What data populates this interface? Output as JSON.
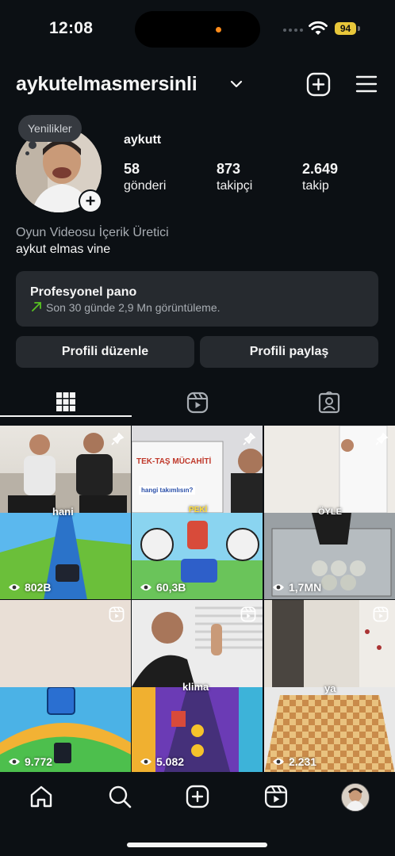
{
  "status_bar": {
    "time": "12:08",
    "battery": "94"
  },
  "header": {
    "username": "aykutelmasmersinli"
  },
  "profile": {
    "note": "Yenilikler",
    "display_name": "aykutt",
    "stats": [
      {
        "value": "58",
        "label": "gönderi"
      },
      {
        "value": "873",
        "label": "takipçi"
      },
      {
        "value": "2.649",
        "label": "takip"
      }
    ],
    "category": "Oyun Videosu İçerik Üretici",
    "bio": "aykut elmas vine"
  },
  "dashboard": {
    "title": "Profesyonel pano",
    "subtitle": "Son 30 günde 2,9 Mn görüntüleme."
  },
  "buttons": {
    "edit": "Profili düzenle",
    "share": "Profili paylaş"
  },
  "tabs": [
    "grid-icon",
    "reels-icon",
    "tagged-icon"
  ],
  "grid": [
    {
      "views": "802B",
      "tag": "hani",
      "icon": "pin-icon"
    },
    {
      "views": "60,3B",
      "tag": "PEKİ",
      "icon": "pin-icon",
      "board_text": "TEK-TAŞ MÜCAHİTİ",
      "caption": "hangi takımlısın?"
    },
    {
      "views": "1,7MN",
      "tag": "ÖYLE",
      "icon": "pin-icon"
    },
    {
      "views": "9.772",
      "tag": "",
      "icon": "reels-icon"
    },
    {
      "views": "5.082",
      "tag": "klima",
      "icon": "reels-icon"
    },
    {
      "views": "2.231",
      "tag": "ya",
      "icon": "reels-icon"
    }
  ],
  "bottom_nav": [
    "home-icon",
    "search-icon",
    "create-icon",
    "reels-icon",
    "profile-avatar"
  ],
  "colors": {
    "background": "#0c1014",
    "surface": "#262a2f",
    "text": "#f5f5f5",
    "muted": "#a8adb3",
    "accent_green": "#58c322"
  }
}
